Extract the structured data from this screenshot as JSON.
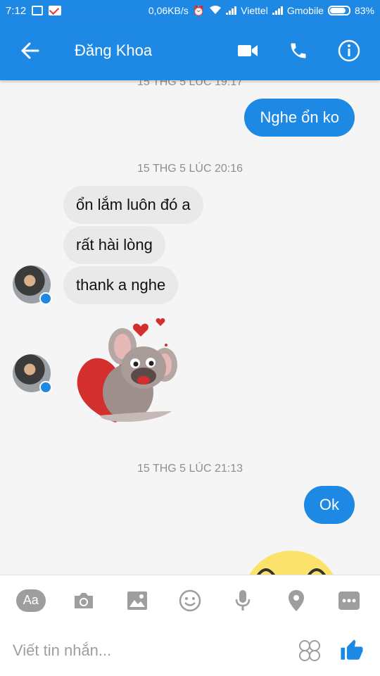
{
  "status_bar": {
    "time": "7:12",
    "speed": "0,06KB/s",
    "carrier1": "Viettel",
    "carrier2": "Gmobile",
    "battery": "83%"
  },
  "header": {
    "title": "Đăng Khoa",
    "accent": "#1e88e5"
  },
  "messages": {
    "ts_top_partial": "15 THG 5 LÚC 19:17",
    "out1": "Nghe ổn ko",
    "ts1": "15 THG 5 LÚC 20:16",
    "in1": "ổn lắm luôn đó a",
    "in2": "rất hài lòng",
    "in3": "thank a nghe",
    "ts2": "15 THG 5 LÚC 21:13",
    "out2": "Ok"
  },
  "toolbar": {
    "aa_label": "Aa",
    "icons": [
      "camera-icon",
      "image-icon",
      "emoji-icon",
      "microphone-icon",
      "location-icon",
      "more-icon"
    ]
  },
  "composer": {
    "placeholder": "Viết tin nhắn..."
  }
}
